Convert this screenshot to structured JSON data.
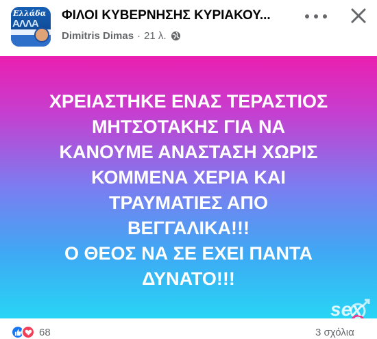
{
  "header": {
    "group_name": "ΦΙΛΟΙ ΚΥΒΕΡΝΗΣΗΣ ΚΥΡΙΑΚΟΥ...",
    "author": "Dimitris Dimas",
    "separator": "·",
    "time": "21 λ.",
    "avatar_text": "Ελλάδα",
    "avatar_big": "ΑΛΛΑ"
  },
  "post": {
    "lines": [
      "ΧΡΕΙΑΣΤΗΚΕ ΕΝΑΣ ΤΕΡΑΣΤΙΟΣ",
      "ΜΗΤΣΟΤΑΚΗΣ ΓΙΑ ΝΑ",
      "ΚΑΝΟΥΜΕ ΑΝΑΣΤΑΣΗ ΧΩΡΙΣ",
      "ΚΟΜΜΕΝΑ ΧΕΡΙΑ ΚΑΙ",
      "ΤΡΑΥΜΑΤΙΕΣ ΑΠΟ",
      "ΒΕΓΓΑΛΙΚΑ!!!",
      "Ο ΘΕΟΣ ΝΑ ΣΕ ΕΧΕΙ ΠΑΝΤΑ",
      "ΔΥΝΑΤΟ!!!"
    ],
    "background_colors": [
      "#ea1fb0",
      "#7b7df0",
      "#27d5f5"
    ]
  },
  "footer": {
    "reaction_count": "68",
    "comments": "3 σχόλια"
  },
  "watermark": {
    "text": "sex"
  },
  "icons": {
    "more": "more-horizontal-icon",
    "close": "close-icon",
    "audience": "globe-icon",
    "like": "like-icon",
    "love": "love-icon"
  },
  "colors": {
    "accent": "#1877f2",
    "love": "#f33e58",
    "secondary_text": "#65676b"
  }
}
